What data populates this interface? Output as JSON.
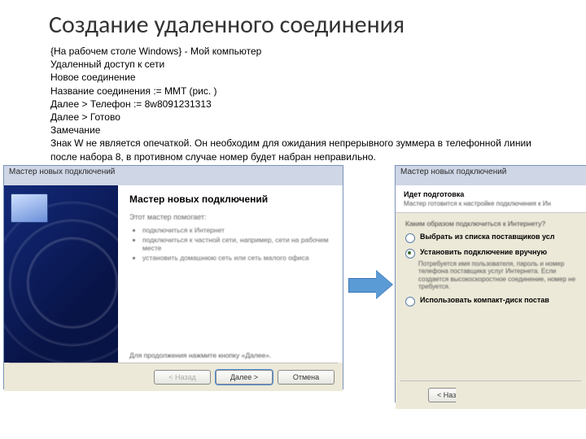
{
  "title": "Создание удаленного соединения",
  "lines": [
    "{На рабочем столе Windows} - Мой компьютер",
    "Удаленный доступ к сети",
    "Новое соединение",
    "Название соединения := MMT (рис. )",
    "Далее > Телефон := 8w8091231313",
    "Далее > Готово",
    "Замечание",
    "Знак W не является опечаткой. Он необходим для ожидания непрерывного зуммера в телефонной линии после набора 8, в противном случае номер будет набран неправильно."
  ],
  "wizard_left": {
    "titlebar": "Мастер новых подключений",
    "heading": "Мастер новых подключений",
    "sub": "Этот мастер помогает:",
    "bullets": [
      "подключиться к Интернет",
      "подключиться к частной сети, например, сети на рабочем месте",
      "установить домашнюю сеть или сеть малого офиса"
    ],
    "footnote": "Для продолжения нажмите кнопку «Далее».",
    "btn_back": "< Назад",
    "btn_next": "Далее >",
    "btn_cancel": "Отмена"
  },
  "wizard_right": {
    "titlebar": "Мастер новых подключений",
    "heading": "Идет подготовка",
    "subheading": "Мастер готовится к настройке подключения к Ин",
    "lead": "Каким образом подключиться к Интернету?",
    "options": [
      {
        "label": "Выбрать из списка поставщиков усл",
        "desc": ""
      },
      {
        "label": "Установить подключение вручную",
        "desc": "Потребуется имя пользователя, пароль и номер телефона поставщика услуг Интернета. Если создается высокоскоростное соединение, номер не требуется."
      },
      {
        "label": "Использовать компакт-диск постав",
        "desc": ""
      }
    ],
    "btn_back": "< Наз"
  }
}
